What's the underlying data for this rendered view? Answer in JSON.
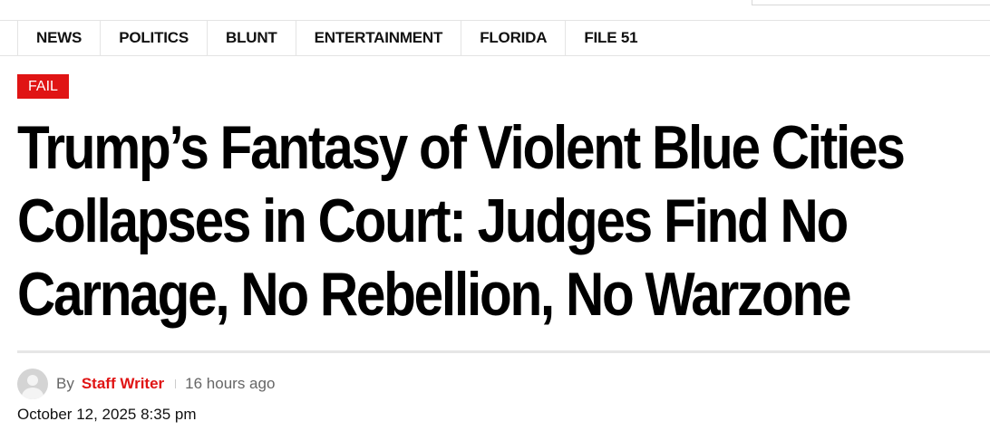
{
  "nav": {
    "items": [
      {
        "label": "NEWS"
      },
      {
        "label": "POLITICS"
      },
      {
        "label": "BLUNT"
      },
      {
        "label": "ENTERTAINMENT"
      },
      {
        "label": "FLORIDA"
      },
      {
        "label": "FILE 51"
      }
    ]
  },
  "article": {
    "category": "FAIL",
    "headline": "Trump’s Fantasy of Violent Blue Cities Collapses in Court: Judges Find No Carnage, No Rebellion, No Warzone",
    "byline": {
      "by_label": "By",
      "author": "Staff Writer",
      "time_ago": "16 hours ago",
      "date": "October 12, 2025 8:35 pm"
    }
  },
  "colors": {
    "accent": "#e01414",
    "text": "#111111",
    "muted": "#666666",
    "border": "#e4e4e4"
  },
  "icons": {
    "avatar": "user-avatar-icon"
  }
}
